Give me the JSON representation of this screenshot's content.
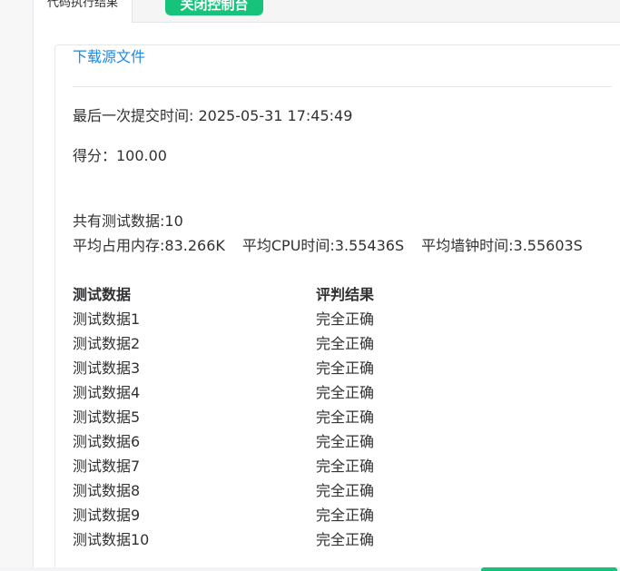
{
  "tabs": {
    "active_label": "代码执行结果",
    "close_console_label": "关闭控制台"
  },
  "result": {
    "download_label": "下载源文件",
    "last_submit": "最后一次提交时间: 2025-05-31 17:45:49",
    "score": "得分：100.00",
    "test_count": "共有测试数据:10",
    "avg_memory": "平均占用内存:83.266K",
    "avg_cpu": "平均CPU时间:3.55436S",
    "avg_wall": "平均墙钟时间:3.55603S"
  },
  "table": {
    "headers": [
      "测试数据",
      "评判结果"
    ],
    "rows": [
      [
        "测试数据1",
        "完全正确"
      ],
      [
        "测试数据2",
        "完全正确"
      ],
      [
        "测试数据3",
        "完全正确"
      ],
      [
        "测试数据4",
        "完全正确"
      ],
      [
        "测试数据5",
        "完全正确"
      ],
      [
        "测试数据6",
        "完全正确"
      ],
      [
        "测试数据7",
        "完全正确"
      ],
      [
        "测试数据8",
        "完全正确"
      ],
      [
        "测试数据9",
        "完全正确"
      ],
      [
        "测试数据10",
        "完全正确"
      ]
    ]
  },
  "colors": {
    "accent_green": "#17c27a",
    "link_blue": "#1e88e5"
  }
}
